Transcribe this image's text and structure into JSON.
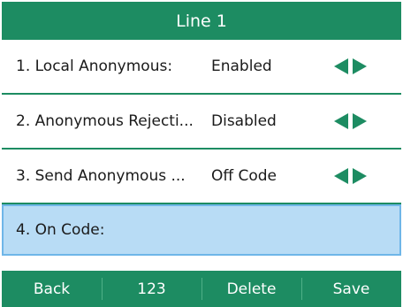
{
  "title": "Line 1",
  "rows": [
    {
      "label": "1. Local Anonymous:",
      "value": "Enabled"
    },
    {
      "label": "2. Anonymous Rejecti...",
      "value": "Disabled"
    },
    {
      "label": "3. Send Anonymous ...",
      "value": "Off Code"
    },
    {
      "label": "4. On Code:",
      "value": ""
    }
  ],
  "softkeys": {
    "back": "Back",
    "numeric": "123",
    "delete": "Delete",
    "save": "Save"
  },
  "colors": {
    "brand_green": "#1d8c62",
    "selected_row": "#b8dcf5",
    "selected_border": "#6fb6e8"
  },
  "icons": {
    "left_arrow": "left-arrow-icon",
    "right_arrow": "right-arrow-icon"
  }
}
